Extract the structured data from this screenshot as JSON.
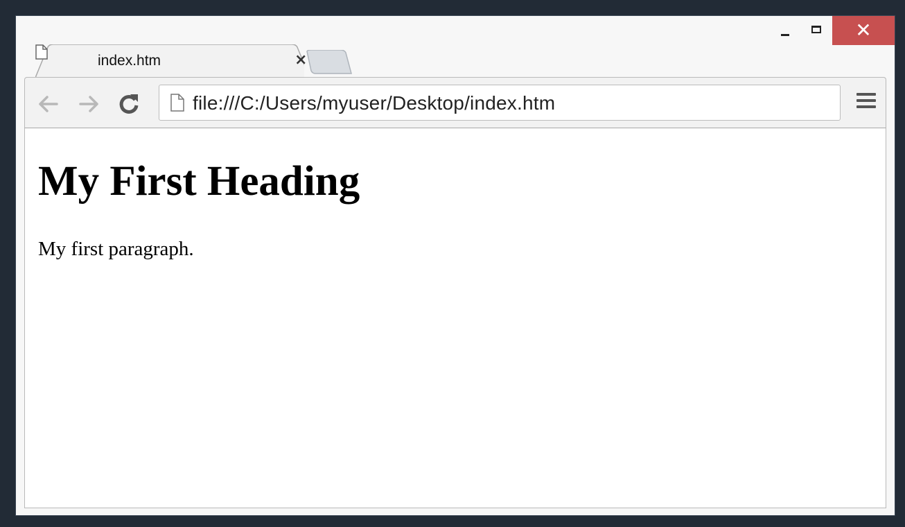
{
  "window": {
    "controls": {
      "minimize_icon": "minimize-icon",
      "maximize_icon": "maximize-icon",
      "close_symbol": "✕",
      "close_color": "#c75050"
    }
  },
  "tabs": [
    {
      "title": "index.htm",
      "icon": "page-icon",
      "close_symbol": "×",
      "active": true
    }
  ],
  "toolbar": {
    "back_icon": "back-arrow-icon",
    "forward_icon": "forward-arrow-icon",
    "reload_icon": "reload-icon",
    "address": {
      "value": "file:///C:/Users/myuser/Desktop/index.htm",
      "icon": "page-icon"
    },
    "menu_icon": "hamburger-menu-icon"
  },
  "page": {
    "heading": "My First Heading",
    "paragraph": "My first paragraph."
  }
}
